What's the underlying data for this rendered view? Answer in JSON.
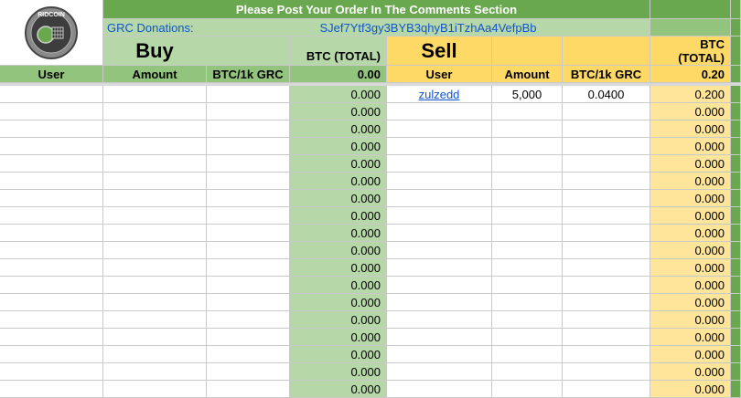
{
  "header": {
    "banner": "Please Post Your Order In The Comments Section",
    "donation_label": "GRC Donations:",
    "donation_address": "SJef7Ytf3gy3BYB3qhyB1iTzhAa4VefpBb",
    "logo_text": "RIDCOIN"
  },
  "buy": {
    "title": "Buy",
    "btc_total_label": "BTC (TOTAL)",
    "btc_total_value": "0.00",
    "columns": [
      "User",
      "Amount",
      "BTC/1k GRC"
    ]
  },
  "sell": {
    "title": "Sell",
    "btc_total_label": "BTC (TOTAL)",
    "btc_total_value": "0.20",
    "columns": [
      "User",
      "Amount",
      "BTC/1k GRC"
    ]
  },
  "buy_rows": [
    "0.000",
    "0.000",
    "0.000",
    "0.000",
    "0.000",
    "0.000",
    "0.000",
    "0.000",
    "0.000",
    "0.000",
    "0.000",
    "0.000",
    "0.000",
    "0.000",
    "0.000",
    "0.000",
    "0.000",
    "0.000"
  ],
  "sell_rows": [
    {
      "user": "zulzedd",
      "amount": "5,000",
      "rate": "0.0400",
      "total": "0.200"
    },
    {
      "user": "",
      "amount": "",
      "rate": "",
      "total": "0.000"
    },
    {
      "user": "",
      "amount": "",
      "rate": "",
      "total": "0.000"
    },
    {
      "user": "",
      "amount": "",
      "rate": "",
      "total": "0.000"
    },
    {
      "user": "",
      "amount": "",
      "rate": "",
      "total": "0.000"
    },
    {
      "user": "",
      "amount": "",
      "rate": "",
      "total": "0.000"
    },
    {
      "user": "",
      "amount": "",
      "rate": "",
      "total": "0.000"
    },
    {
      "user": "",
      "amount": "",
      "rate": "",
      "total": "0.000"
    },
    {
      "user": "",
      "amount": "",
      "rate": "",
      "total": "0.000"
    },
    {
      "user": "",
      "amount": "",
      "rate": "",
      "total": "0.000"
    },
    {
      "user": "",
      "amount": "",
      "rate": "",
      "total": "0.000"
    },
    {
      "user": "",
      "amount": "",
      "rate": "",
      "total": "0.000"
    },
    {
      "user": "",
      "amount": "",
      "rate": "",
      "total": "0.000"
    },
    {
      "user": "",
      "amount": "",
      "rate": "",
      "total": "0.000"
    },
    {
      "user": "",
      "amount": "",
      "rate": "",
      "total": "0.000"
    },
    {
      "user": "",
      "amount": "",
      "rate": "",
      "total": "0.000"
    },
    {
      "user": "",
      "amount": "",
      "rate": "",
      "total": "0.000"
    },
    {
      "user": "",
      "amount": "",
      "rate": "",
      "total": "0.000"
    }
  ],
  "colors": {
    "green_dark": "#6aa84f",
    "green_mid": "#93c47d",
    "green_light": "#b6d7a8",
    "yellow_light": "#ffe599",
    "yellow_mid": "#ffd966",
    "link": "#1155cc"
  }
}
